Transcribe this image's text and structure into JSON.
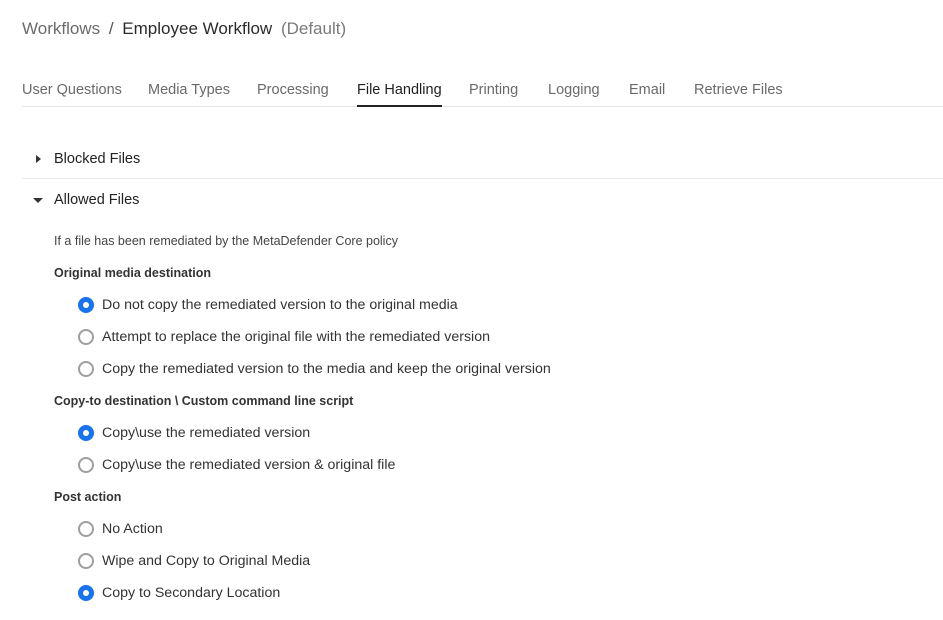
{
  "breadcrumb": {
    "root": "Workflows",
    "separator": "/",
    "current": "Employee Workflow",
    "suffix": "(Default)"
  },
  "tabs": [
    {
      "label": "User Questions",
      "active": false
    },
    {
      "label": "Media Types",
      "active": false
    },
    {
      "label": "Processing",
      "active": false
    },
    {
      "label": "File Handling",
      "active": true
    },
    {
      "label": "Printing",
      "active": false
    },
    {
      "label": "Logging",
      "active": false
    },
    {
      "label": "Email",
      "active": false
    },
    {
      "label": "Retrieve Files",
      "active": false
    }
  ],
  "sections": {
    "blocked": {
      "title": "Blocked Files",
      "expanded": false
    },
    "allowed": {
      "title": "Allowed Files",
      "expanded": true
    }
  },
  "allowed": {
    "note": "If a file has been remediated by the MetaDefender Core policy",
    "original_media": {
      "label": "Original media destination",
      "options": [
        {
          "label": "Do not copy the remediated version to the original media",
          "checked": true
        },
        {
          "label": "Attempt to replace the original file with the remediated version",
          "checked": false
        },
        {
          "label": "Copy the remediated version to the media and keep the original version",
          "checked": false
        }
      ]
    },
    "copy_to": {
      "label": "Copy-to destination \\ Custom command line script",
      "options": [
        {
          "label": "Copy\\use the remediated version",
          "checked": true
        },
        {
          "label": "Copy\\use the remediated version & original file",
          "checked": false
        }
      ]
    },
    "post_action": {
      "label": "Post action",
      "options": [
        {
          "label": "No Action",
          "checked": false
        },
        {
          "label": "Wipe and Copy to Original Media",
          "checked": false
        },
        {
          "label": "Copy to Secondary Location",
          "checked": true
        }
      ]
    }
  },
  "colors": {
    "accent": "#1a73e8",
    "tab_underline": "#222222",
    "divider": "#e8e8e8"
  }
}
